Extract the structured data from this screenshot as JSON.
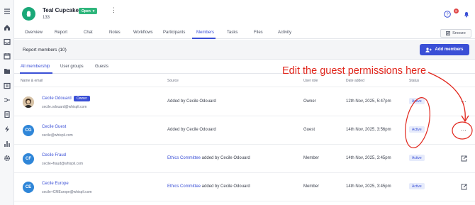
{
  "app": {
    "title": "Teal Cupcake",
    "subtitle": "133",
    "status": "Open",
    "notification_count": "8"
  },
  "tabs": [
    {
      "label": "Overview"
    },
    {
      "label": "Report"
    },
    {
      "label": "Chat"
    },
    {
      "label": "Notes"
    },
    {
      "label": "Workflows"
    },
    {
      "label": "Participants"
    },
    {
      "label": "Members",
      "active": true
    },
    {
      "label": "Tasks"
    },
    {
      "label": "Files"
    },
    {
      "label": "Activity"
    }
  ],
  "snooze_label": "Snooze",
  "members": {
    "title": "Report members (10)",
    "add_label": "Add members"
  },
  "subtabs": [
    {
      "label": "All membership",
      "active": true
    },
    {
      "label": "User groups"
    },
    {
      "label": "Guests"
    }
  ],
  "table": {
    "headers": [
      "Name & email",
      "Source",
      "User role",
      "Date added",
      "Status"
    ],
    "rows": [
      {
        "initials": "",
        "name": "Cecile Odouard",
        "badge": "Owner",
        "email": "cecile.odouard@whispli.com",
        "source_link": "",
        "source": "Added by Cecile Odouard",
        "role": "Owner",
        "date": "12th Nov, 2025, 5:47pm",
        "status": "Active",
        "action": "more"
      },
      {
        "initials": "CG",
        "name": "Cecile Guest",
        "badge": "",
        "email": "cecile@whispli.com",
        "source_link": "",
        "source": "Added by Cecile Odouard",
        "role": "Guest",
        "date": "14th Nov, 2025, 3:56pm",
        "status": "Active",
        "action": "more"
      },
      {
        "initials": "CF",
        "name": "Cecile Fraud",
        "badge": "",
        "email": "cecile+fraud@whispli.com",
        "source_link": "Ethics Committee",
        "source": " added by Cecile Odouard",
        "role": "Member",
        "date": "14th Nov, 2025, 3:45pm",
        "status": "Active",
        "action": "open"
      },
      {
        "initials": "CE",
        "name": "Cecile Europe",
        "badge": "",
        "email": "cecile+CMEurope@whispli.com",
        "source_link": "Ethics Committee",
        "source": " added by Cecile Odouard",
        "role": "Member",
        "date": "14th Nov, 2025, 3:45pm",
        "status": "Active",
        "action": "open"
      }
    ]
  },
  "annotation": "Edit the guest permissions here",
  "colors": {
    "accent": "#3a4fd6",
    "open_status": "#2fb67c",
    "annotation": "#e1261c"
  },
  "icons": {
    "rail": [
      "menu-icon",
      "home-icon",
      "inbox-icon",
      "calendar-icon",
      "folder-icon",
      "list-icon",
      "merge-icon",
      "clipboard-icon",
      "bolt-icon",
      "bar-chart-icon",
      "settings-icon"
    ]
  }
}
